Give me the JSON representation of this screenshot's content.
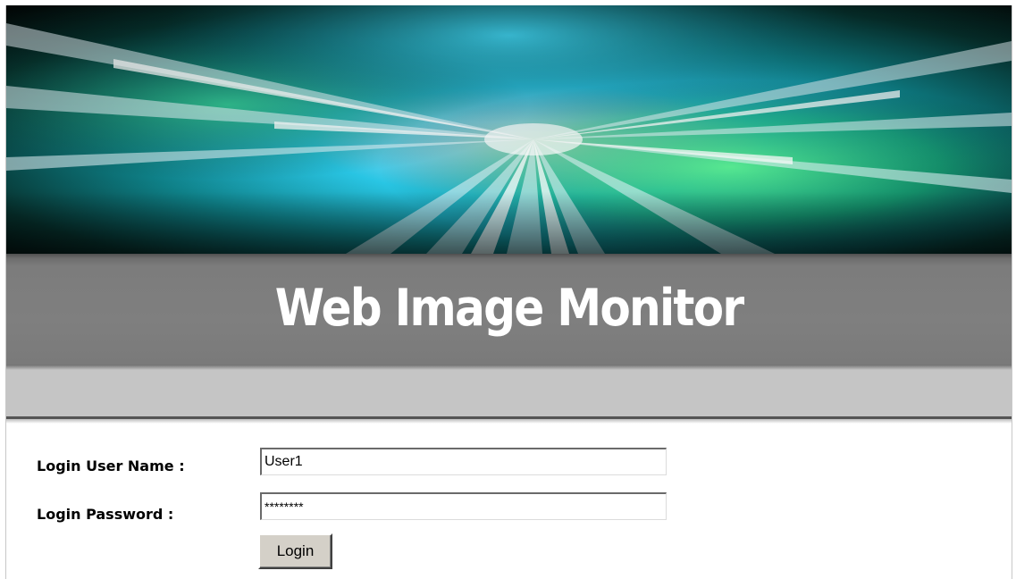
{
  "header": {
    "title": "Web Image Monitor"
  },
  "login_form": {
    "user_name_label": "Login User Name :",
    "user_name_value": "User1",
    "password_label": "Login Password :",
    "password_value": "********",
    "login_button_label": "Login"
  },
  "colors": {
    "title_band": "#7f7f7f",
    "sub_bar": "#c5c5c5",
    "banner_cyan": "#1fd1f0",
    "banner_green": "#22d96a"
  }
}
